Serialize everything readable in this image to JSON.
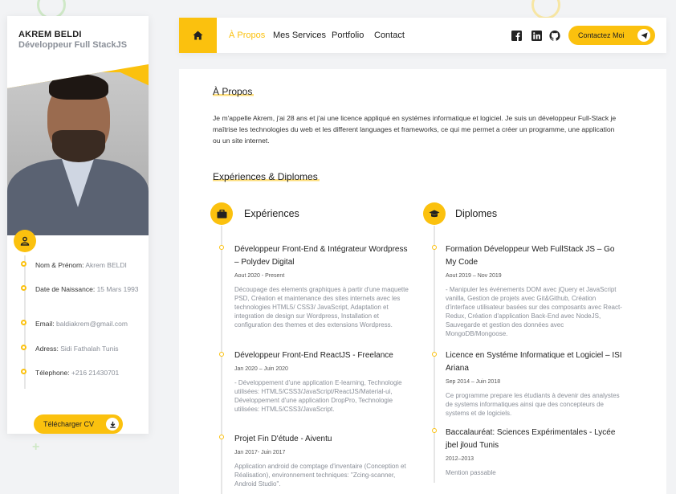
{
  "profile": {
    "name": "AKREM BELDI",
    "role": "Développeur Full StackJS",
    "info": [
      {
        "label": "Nom & Prénom:",
        "value": "Akrem BELDI"
      },
      {
        "label": "Date de Naissance:",
        "value": "15 Mars 1993"
      },
      {
        "label": "Email:",
        "value": "baldiakrem@gmail.com"
      },
      {
        "label": "Adress:",
        "value": "Sidi Fathalah Tunis"
      },
      {
        "label": "Télephone:",
        "value": "+216 21430701"
      }
    ],
    "cv_button": "Télécharger CV"
  },
  "nav": {
    "links": [
      "À Propos",
      "Mes Services",
      "Portfolio",
      "Contact"
    ],
    "active": "À Propos",
    "contact_button": "Contactez Moi",
    "social_icons": [
      "facebook-icon",
      "linkedin-icon",
      "github-icon"
    ]
  },
  "about": {
    "title": "À Propos",
    "text": "Je m'appelle Akrem, j'ai 28 ans et j'ai une licence appliqué en systémes informatique et logiciel. Je suis un développeur Full-Stack je maîtrise les technologies du web et les different languages et frameworks, ce qui me permet a créer un programme, une application ou un site internet."
  },
  "experiences_section": {
    "title": "Expériences & Diplomes",
    "experiences": {
      "heading": "Expériences",
      "items": [
        {
          "title": "Développeur Front-End & Intégrateur Wordpress – Polydev Digital",
          "date": "Aout 2020 - Present",
          "desc": "Découpage des elements graphiques à partir d'une maquette PSD, Création et maintenance des sites internets avec les technologies HTML5/ CSS3/ JavaScript, Adaptation et integration de design sur Wordpress, Installation et configuration des themes et des extensions Wordpress."
        },
        {
          "title": "Développeur Front-End ReactJS - Freelance",
          "date": "Jan 2020 – Juin 2020",
          "desc": "- Développement d'une application E-learning, Technologie utilisées: HTML5/CSS3/JavaScript/ReactJS/Material-ui, Développement d'une application DropPro, Technologie utilisées: HTML5/CSS3/JavaScript."
        },
        {
          "title": "Projet Fin D'étude - Aiventu",
          "date": "Jan 2017- Juin 2017",
          "desc": "Application android de comptage d'inventaire (Conception et Réalisation), environnement techniques: \"Zcing-scanner, Android Studio\"."
        }
      ]
    },
    "diplomes": {
      "heading": "Diplomes",
      "items": [
        {
          "title": "Formation Développeur Web FullStack JS – Go My Code",
          "date": "Aout 2019 – Nov 2019",
          "desc": "- Manipuler les événements DOM avec jQuery et JavaScript vanilla, Gestion de projets avec Git&Github, Création d'interface utilisateur basées sur des composants avec React-Redux, Création d'application Back-End avec NodeJS, Sauvegarde et gestion des données avec MongoDB/Mongoose."
        },
        {
          "title": "Licence en Systéme Informatique et Logiciel – ISI Ariana",
          "date": "Sep 2014 – Juin 2018",
          "desc": "Ce programme prepare les étudiants à devenir des analystes de systems informatiques ainsi que des concepteurs de systems et de logiciels."
        },
        {
          "title": "Baccalauréat: Sciences Expérimentales - Lycée jbel jloud Tunis",
          "date": "2012–2013",
          "desc": "Mention passable"
        }
      ]
    }
  },
  "colors": {
    "accent": "#fbc10e",
    "muted": "#8a8f98"
  }
}
